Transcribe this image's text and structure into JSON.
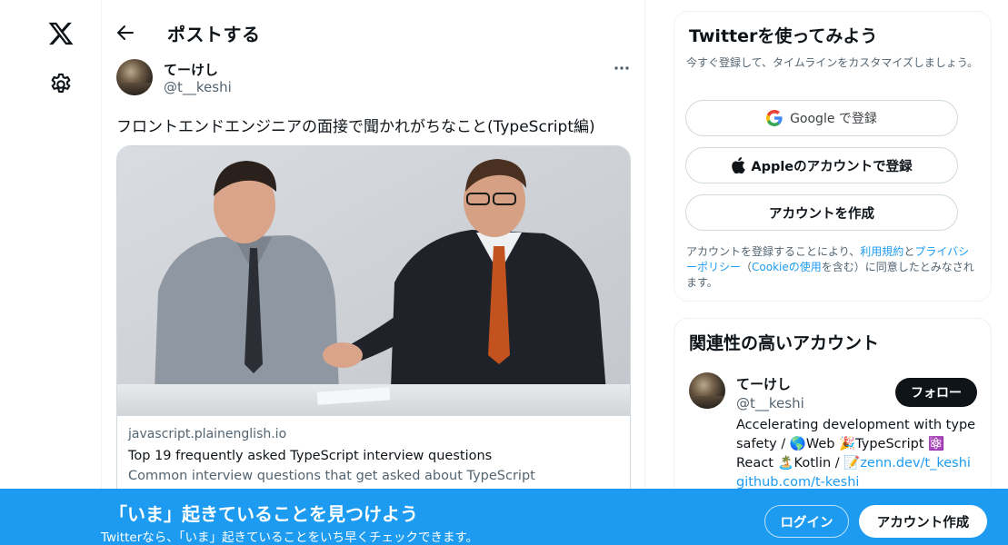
{
  "nav": {
    "logo_icon": "x-logo-icon",
    "settings_icon": "gear-icon"
  },
  "header": {
    "title": "ポストする",
    "back_icon": "arrow-left-icon"
  },
  "post": {
    "author_name": "てーけし",
    "author_handle": "@t__keshi",
    "more_icon": "more-horizontal-icon",
    "text": "フロントエンドエンジニアの面接で聞かれがちなこと(TypeScript編)",
    "card": {
      "domain": "javascript.plainenglish.io",
      "title": "Top 19 frequently asked TypeScript interview questions",
      "description": "Common interview questions that get asked about TypeScript"
    }
  },
  "signup": {
    "title": "Twitterを使ってみよう",
    "subtitle": "今すぐ登録して、タイムラインをカスタマイズしましょう。",
    "google_label": "Google で登録",
    "apple_label": "Appleのアカウントで登録",
    "create_label": "アカウントを作成",
    "terms_prefix": "アカウントを登録することにより、",
    "terms_link": "利用規約",
    "terms_and": "と",
    "privacy_link": "プライバシーポリシー",
    "terms_paren_open": "（",
    "cookie_link": "Cookieの使用",
    "terms_suffix": "を含む）に同意したとみなされます。"
  },
  "related": {
    "title": "関連性の高いアカウント",
    "name": "てーけし",
    "handle": "@t__keshi",
    "follow_label": "フォロー",
    "bio_1": "Accelerating development with type safety / 🌎Web 🎉TypeScript ⚛️ React 🏝️Kotlin / 📝",
    "bio_link_1": "zenn.dev/t_keshi",
    "bio_link_2": "github.com/t-keshi"
  },
  "banner": {
    "title": "「いま」起きていることを見つけよう",
    "subtitle": "Twitterなら、「いま」起きていることをいち早くチェックできます。",
    "login_label": "ログイン",
    "signup_label": "アカウント作成"
  },
  "colors": {
    "accent": "#1d9bf0",
    "text": "#0f1419",
    "muted": "#536471"
  }
}
